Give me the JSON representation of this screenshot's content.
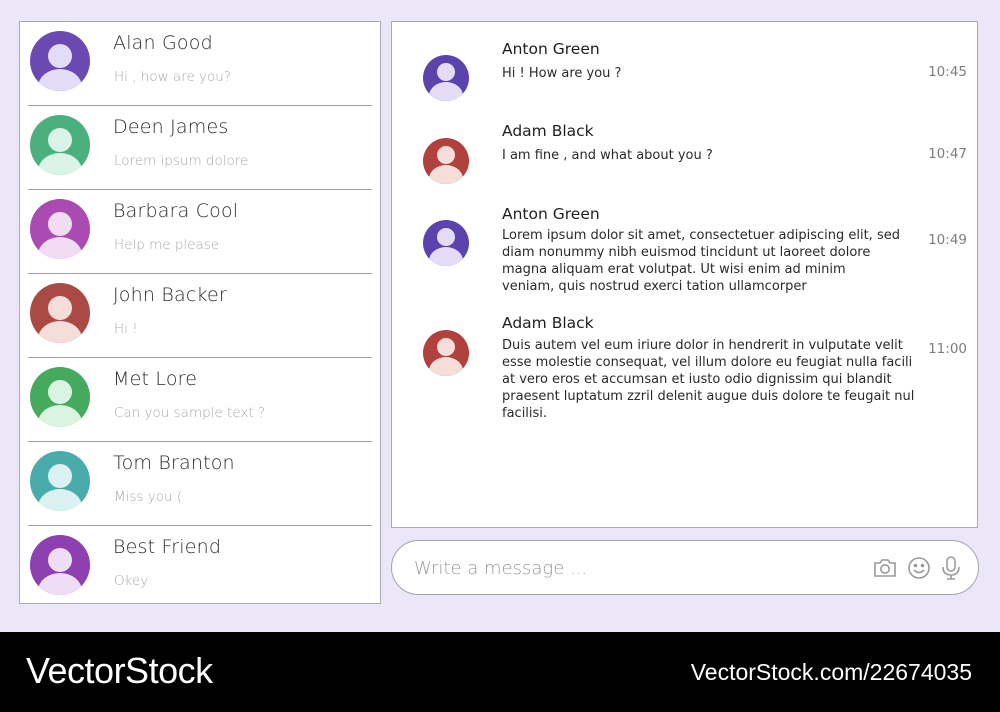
{
  "contacts": [
    {
      "name": "Alan Good",
      "preview": "Hi , how are you?",
      "avatar_bg": "#6b49b3",
      "avatar_fg": "#e3dcf6"
    },
    {
      "name": "Deen James",
      "preview": "Lorem ipsum dolore",
      "avatar_bg": "#4caf7e",
      "avatar_fg": "#dcf3e8"
    },
    {
      "name": "Barbara Cool",
      "preview": "Help me please",
      "avatar_bg": "#a94bb0",
      "avatar_fg": "#f2dcf3"
    },
    {
      "name": "John Backer",
      "preview": "Hi !",
      "avatar_bg": "#ab4a45",
      "avatar_fg": "#f5ded9"
    },
    {
      "name": "Met Lore",
      "preview": "Can you sample text ?",
      "avatar_bg": "#45aa5e",
      "avatar_fg": "#dbf3e1"
    },
    {
      "name": "Tom Branton",
      "preview": "Miss you (",
      "avatar_bg": "#4aabad",
      "avatar_fg": "#dcf2f2"
    },
    {
      "name": "Best Friend",
      "preview": "Okey",
      "avatar_bg": "#8e3fb0",
      "avatar_fg": "#efdcf5"
    }
  ],
  "messages": [
    {
      "author": "Anton Green",
      "text": "Hi ! How are you ?",
      "time": "10:45",
      "avatar_bg": "#5b43ad",
      "avatar_fg": "#e3dcf6"
    },
    {
      "author": "Adam Black",
      "text": "I am fine , and what about you ?",
      "time": "10:47",
      "avatar_bg": "#b0413d",
      "avatar_fg": "#f5ded9"
    },
    {
      "author": "Anton Green",
      "text": "Lorem ipsum dolor sit amet, consectetuer adipiscing elit, sed diam nonummy nibh euismod tincidunt ut laoreet dolore magna aliquam erat volutpat. Ut wisi enim ad minim veniam, quis nostrud exerci tation ullamcorper",
      "time": "10:49",
      "avatar_bg": "#5b43ad",
      "avatar_fg": "#e3dcf6"
    },
    {
      "author": "Adam Black",
      "text": "Duis autem vel eum iriure dolor in hendrerit in vulputate velit esse molestie consequat, vel illum dolore eu feugiat nulla facili at vero eros et accumsan et iusto odio dignissim qui blandit praesent luptatum zzril delenit augue duis dolore te feugait nul facilisi.",
      "time": "11:00",
      "avatar_bg": "#b0413d",
      "avatar_fg": "#f5ded9"
    }
  ],
  "composer": {
    "placeholder": "Write a message ...",
    "icons": [
      "camera-icon",
      "smiley-icon",
      "microphone-icon"
    ]
  },
  "footer": {
    "brand": "VectorStock",
    "url": "VectorStock.com/22674035"
  }
}
